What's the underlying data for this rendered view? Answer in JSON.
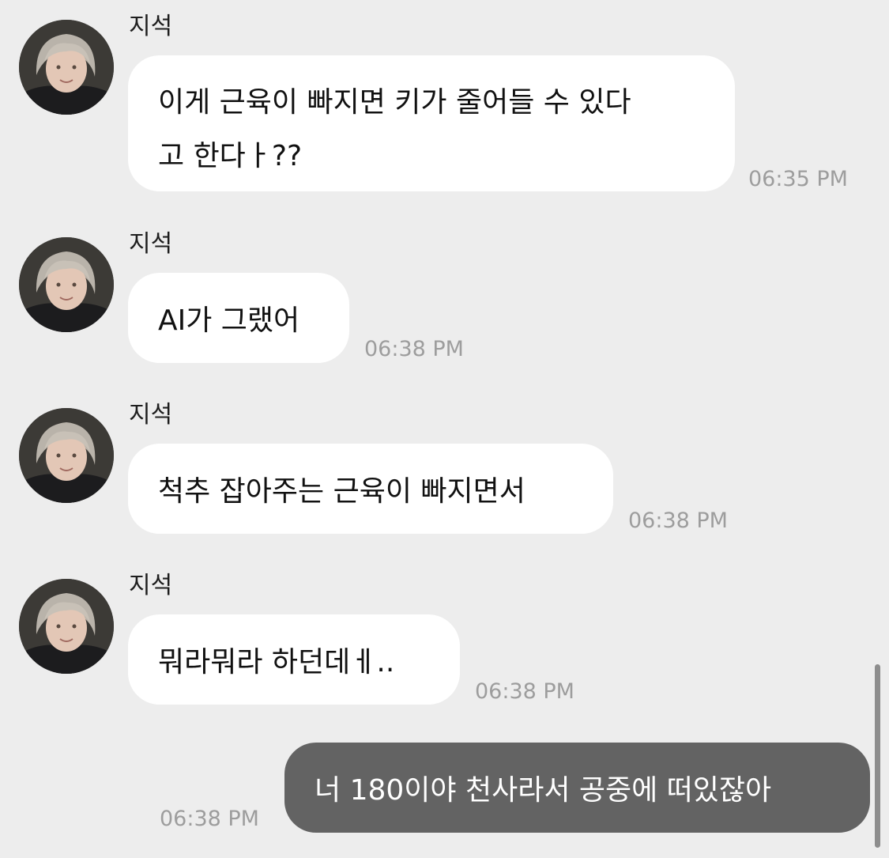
{
  "colors": {
    "background": "#ededed",
    "received_bubble": "#ffffff",
    "sent_bubble": "#636363",
    "timestamp": "#9d9d9d"
  },
  "messages": [
    {
      "sender": "지석",
      "lines": [
        "이게 근육이 빠지면 키가 줄어들 수 있다",
        "고 한다ㅏ??"
      ],
      "time": "06:35 PM",
      "avatar_icon": "profile-avatar-icon"
    },
    {
      "sender": "지석",
      "text": "AI가 그랬어",
      "time": "06:38 PM",
      "avatar_icon": "profile-avatar-icon"
    },
    {
      "sender": "지석",
      "text": "척추 잡아주는 근육이 빠지면서",
      "time": "06:38 PM",
      "avatar_icon": "profile-avatar-icon"
    },
    {
      "sender": "지석",
      "text": "뭐라뭐라 하던데ㅔ..",
      "time": "06:38 PM",
      "avatar_icon": "profile-avatar-icon"
    }
  ],
  "sent": {
    "text": "너 180이야 천사라서 공중에 떠있잖아",
    "time": "06:38 PM"
  }
}
